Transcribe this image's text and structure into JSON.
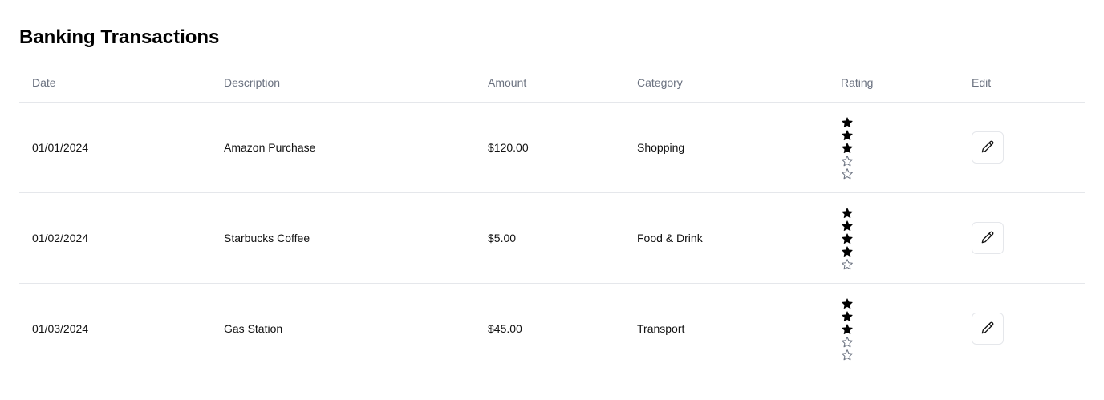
{
  "title": "Banking Transactions",
  "columns": {
    "date": "Date",
    "description": "Description",
    "amount": "Amount",
    "category": "Category",
    "rating": "Rating",
    "edit": "Edit"
  },
  "rating_max": 5,
  "rows": [
    {
      "date": "01/01/2024",
      "description": "Amazon Purchase",
      "amount": "$120.00",
      "category": "Shopping",
      "rating": 3
    },
    {
      "date": "01/02/2024",
      "description": "Starbucks Coffee",
      "amount": "$5.00",
      "category": "Food & Drink",
      "rating": 4
    },
    {
      "date": "01/03/2024",
      "description": "Gas Station",
      "amount": "$45.00",
      "category": "Transport",
      "rating": 3
    }
  ],
  "icons": {
    "filled_star": "star-filled-icon",
    "empty_star": "star-outline-icon",
    "edit": "pencil-icon"
  },
  "colors": {
    "header_text": "#6b7280",
    "border": "#e5e7eb",
    "star_filled": "#000000",
    "star_empty": "#6b7280"
  }
}
